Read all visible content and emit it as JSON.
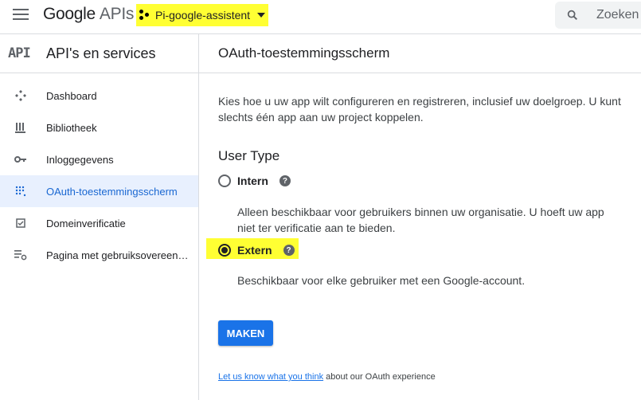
{
  "header": {
    "logo_google": "Google",
    "logo_apis": "APIs",
    "project_name": "Pi-google-assistent",
    "search_placeholder": "Zoeken",
    "project_highlight_color": "#ffff33"
  },
  "sidebar": {
    "api_badge": "API",
    "title": "API's en services",
    "items": [
      {
        "label": "Dashboard",
        "icon": "dashboard-icon",
        "active": false
      },
      {
        "label": "Bibliotheek",
        "icon": "library-icon",
        "active": false
      },
      {
        "label": "Inloggegevens",
        "icon": "key-icon",
        "active": false
      },
      {
        "label": "OAuth-toestemmingsscherm",
        "icon": "consent-icon",
        "active": true
      },
      {
        "label": "Domeinverificatie",
        "icon": "checkbox-icon",
        "active": false
      },
      {
        "label": "Pagina met gebruiksovereen…",
        "icon": "settings-list-icon",
        "active": false
      }
    ]
  },
  "main": {
    "title": "OAuth-toestemmingsscherm",
    "intro": "Kies hoe u uw app wilt configureren en registreren, inclusief uw doelgroep. U kunt slechts één app aan uw project koppelen.",
    "user_type_heading": "User Type",
    "options": [
      {
        "label": "Intern",
        "selected": false,
        "description": "Alleen beschikbaar voor gebruikers binnen uw organisatie. U hoeft uw app niet ter verificatie aan te bieden."
      },
      {
        "label": "Extern",
        "selected": true,
        "description": "Beschikbaar voor elke gebruiker met een Google-account."
      }
    ],
    "submit_label": "MAKEN",
    "feedback_link": "Let us know what you think",
    "feedback_suffix": " about our OAuth experience"
  },
  "colors": {
    "accent": "#1a73e8",
    "highlight": "#ffff33",
    "active_bg": "#e8f0fe"
  }
}
